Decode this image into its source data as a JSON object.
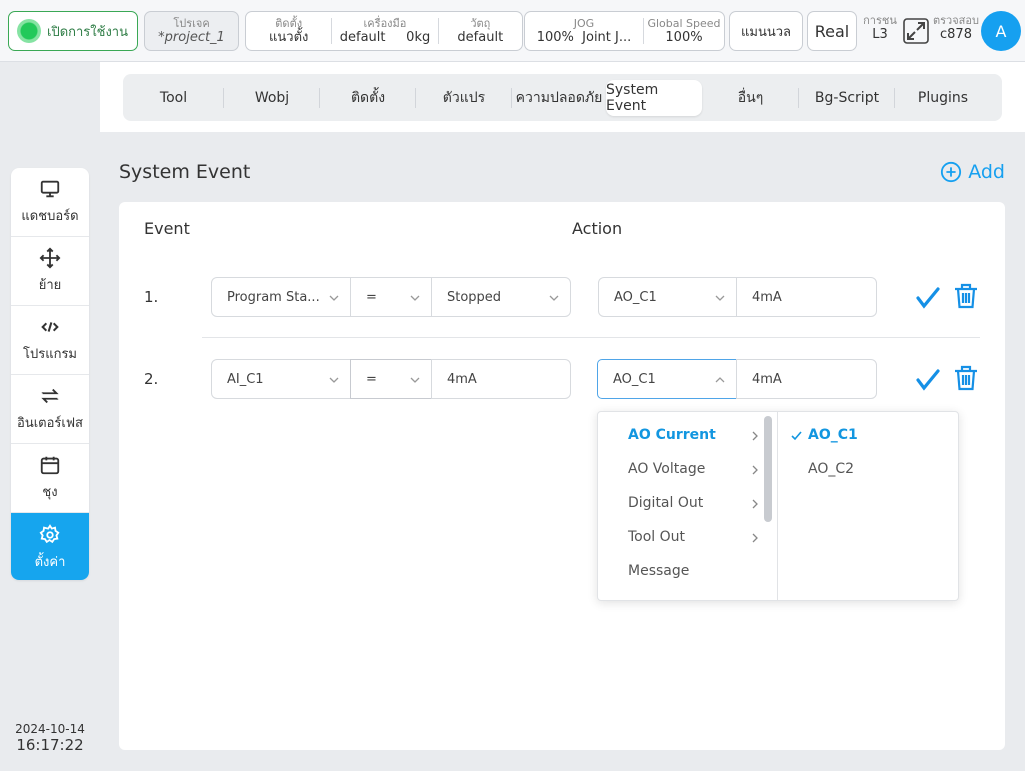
{
  "topbar": {
    "power_label": "เปิดการใช้งาน",
    "project_caption": "โปรเจค",
    "project_name": "*project_1",
    "install_caption": "ติดตั้ง",
    "install_value": "แนวตั้ง",
    "tool_caption": "เครื่องมือ",
    "tool_name": "default",
    "tool_load": "0kg",
    "object_caption": "วัตถุ",
    "object_value": "default",
    "jog_caption": "JOG",
    "jog_percent": "100%",
    "jog_mode": "Joint J...",
    "speed_caption": "Global Speed",
    "speed_value": "100%",
    "manual_label": "แมนนวล",
    "real_label": "Real",
    "level_caption": "การชน",
    "level_value": "L3",
    "check_caption": "ตรวจสอบ",
    "check_value": "c878",
    "avatar_letter": "A"
  },
  "sidebar": {
    "items": [
      {
        "label": "แดชบอร์ด",
        "icon": "monitor-icon"
      },
      {
        "label": "ย้าย",
        "icon": "move-icon"
      },
      {
        "label": "โปรแกรม",
        "icon": "code-icon"
      },
      {
        "label": "อินเตอร์เฟส",
        "icon": "interface-icon"
      },
      {
        "label": "ชุง",
        "icon": "calendar-icon"
      },
      {
        "label": "ตั้งค่า",
        "icon": "gear-icon"
      }
    ],
    "date": "2024-10-14",
    "time": "16:17:22"
  },
  "tabs": [
    {
      "label": "Tool"
    },
    {
      "label": "Wobj"
    },
    {
      "label": "ติดตั้ง"
    },
    {
      "label": "ตัวแปร"
    },
    {
      "label": "ความปลอดภัย"
    },
    {
      "label": "System Event"
    },
    {
      "label": "อื่นๆ"
    },
    {
      "label": "Bg-Script"
    },
    {
      "label": "Plugins"
    }
  ],
  "panel": {
    "title": "System Event",
    "add_label": "Add",
    "event_header": "Event",
    "action_header": "Action"
  },
  "rows": [
    {
      "num": "1.",
      "event_source": "Program Sta...",
      "operator": "=",
      "event_value": "Stopped",
      "action_target": "AO_C1",
      "action_value": "4mA"
    },
    {
      "num": "2.",
      "event_source": "AI_C1",
      "operator": "=",
      "event_value": "4mA",
      "action_target": "AO_C1",
      "action_value": "4mA"
    }
  ],
  "dropdown": {
    "categories": [
      {
        "label": "AO Current"
      },
      {
        "label": "AO Voltage"
      },
      {
        "label": "Digital Out"
      },
      {
        "label": "Tool Out"
      },
      {
        "label": "Message"
      }
    ],
    "options": [
      {
        "label": "AO_C1"
      },
      {
        "label": "AO_C2"
      }
    ]
  },
  "colors": {
    "accent": "#16a0f0",
    "power_green": "#22c95a"
  }
}
